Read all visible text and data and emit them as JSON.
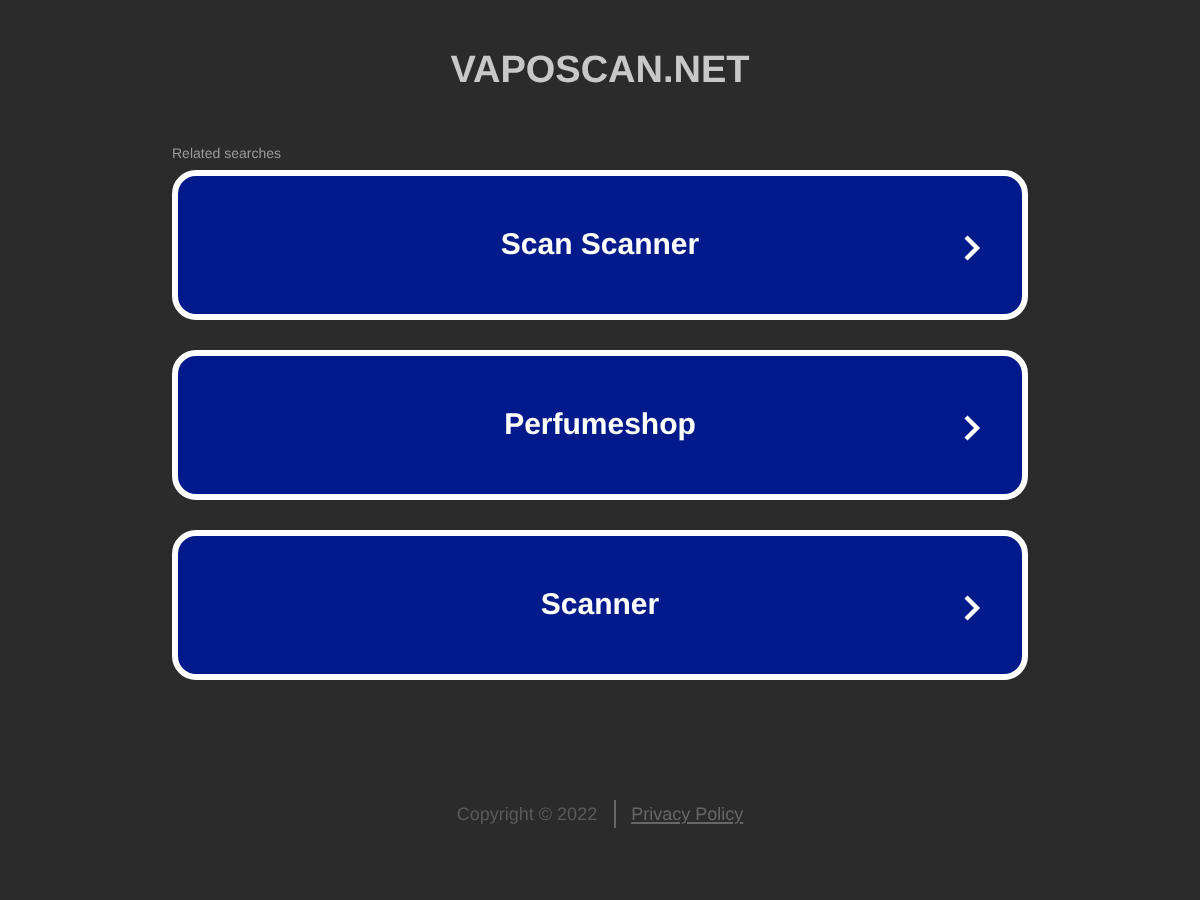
{
  "site_title": "VAPOSCAN.NET",
  "related_heading": "Related searches",
  "searches": [
    {
      "label": "Scan Scanner"
    },
    {
      "label": "Perfumeshop"
    },
    {
      "label": "Scanner"
    }
  ],
  "footer": {
    "copyright": "Copyright © 2022",
    "privacy_link": "Privacy Policy"
  }
}
